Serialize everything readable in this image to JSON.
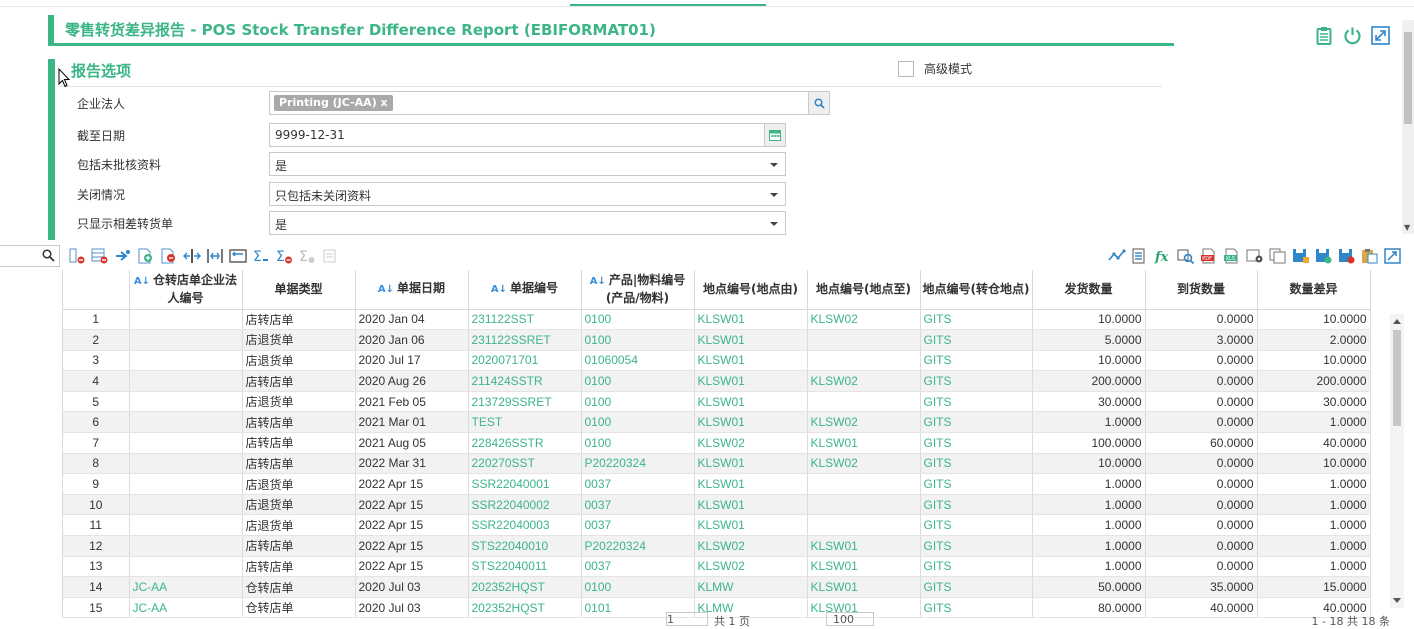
{
  "page": {
    "title": "零售转货差异报告 - POS Stock Transfer Difference Report (EBIFORMAT01)"
  },
  "top_icons": [
    "clipboard-icon",
    "power-icon",
    "expand-icon"
  ],
  "report_options": {
    "title": "报告选项",
    "advanced_label": "高级模式",
    "advanced_checked": false,
    "fields": [
      {
        "label": "企业法人",
        "value": "Printing (JC-AA) x",
        "kind": "tag-search"
      },
      {
        "label": "截至日期",
        "value": "9999-12-31",
        "kind": "date"
      },
      {
        "label": "包括未批核资料",
        "value": "是",
        "kind": "select"
      },
      {
        "label": "关闭情况",
        "value": "只包括未关闭资料",
        "kind": "select"
      },
      {
        "label": "只显示相差转货单",
        "value": "是",
        "kind": "select"
      }
    ]
  },
  "grid": {
    "columns": [
      {
        "label": "",
        "sortable": false
      },
      {
        "label": "仓转店单企业法人编号",
        "sortable": true
      },
      {
        "label": "单据类型",
        "sortable": false
      },
      {
        "label": "单据日期",
        "sortable": true
      },
      {
        "label": "单据编号",
        "sortable": true
      },
      {
        "label": "产品|物料编号(产品/物料)",
        "sortable": true
      },
      {
        "label": "地点编号(地点由)",
        "sortable": false
      },
      {
        "label": "地点编号(地点至)",
        "sortable": false
      },
      {
        "label": "地点编号(转仓地点)",
        "sortable": false
      },
      {
        "label": "发货数量",
        "sortable": false
      },
      {
        "label": "到货数量",
        "sortable": false
      },
      {
        "label": "数量差异",
        "sortable": false
      }
    ],
    "rows": [
      [
        "1",
        "",
        "店转店单",
        "2020 Jan 04",
        "231122SST",
        "0100",
        "KLSW01",
        "KLSW02",
        "GITS",
        "10.0000",
        "0.0000",
        "10.0000"
      ],
      [
        "2",
        "",
        "店退货单",
        "2020 Jan 06",
        "231122SSRET",
        "0100",
        "KLSW01",
        "",
        "GITS",
        "5.0000",
        "3.0000",
        "2.0000"
      ],
      [
        "3",
        "",
        "店退货单",
        "2020 Jul 17",
        "2020071701",
        "01060054",
        "KLSW01",
        "",
        "GITS",
        "10.0000",
        "0.0000",
        "10.0000"
      ],
      [
        "4",
        "",
        "店转店单",
        "2020 Aug 26",
        "211424SSTR",
        "0100",
        "KLSW01",
        "KLSW02",
        "GITS",
        "200.0000",
        "0.0000",
        "200.0000"
      ],
      [
        "5",
        "",
        "店退货单",
        "2021 Feb 05",
        "213729SSRET",
        "0100",
        "KLSW01",
        "",
        "GITS",
        "30.0000",
        "0.0000",
        "30.0000"
      ],
      [
        "6",
        "",
        "店转店单",
        "2021 Mar 01",
        "TEST",
        "0100",
        "KLSW01",
        "KLSW02",
        "GITS",
        "1.0000",
        "0.0000",
        "1.0000"
      ],
      [
        "7",
        "",
        "店转店单",
        "2021 Aug 05",
        "228426SSTR",
        "0100",
        "KLSW02",
        "KLSW01",
        "GITS",
        "100.0000",
        "60.0000",
        "40.0000"
      ],
      [
        "8",
        "",
        "店转店单",
        "2022 Mar 31",
        "220270SST",
        "P20220324",
        "KLSW01",
        "KLSW02",
        "GITS",
        "10.0000",
        "0.0000",
        "10.0000"
      ],
      [
        "9",
        "",
        "店退货单",
        "2022 Apr 15",
        "SSR22040001",
        "0037",
        "KLSW01",
        "",
        "GITS",
        "1.0000",
        "0.0000",
        "1.0000"
      ],
      [
        "10",
        "",
        "店退货单",
        "2022 Apr 15",
        "SSR22040002",
        "0037",
        "KLSW01",
        "",
        "GITS",
        "1.0000",
        "0.0000",
        "1.0000"
      ],
      [
        "11",
        "",
        "店退货单",
        "2022 Apr 15",
        "SSR22040003",
        "0037",
        "KLSW01",
        "",
        "GITS",
        "1.0000",
        "0.0000",
        "1.0000"
      ],
      [
        "12",
        "",
        "店转店单",
        "2022 Apr 15",
        "STS22040010",
        "P20220324",
        "KLSW02",
        "KLSW01",
        "GITS",
        "1.0000",
        "0.0000",
        "1.0000"
      ],
      [
        "13",
        "",
        "店转店单",
        "2022 Apr 15",
        "STS22040011",
        "0037",
        "KLSW02",
        "KLSW01",
        "GITS",
        "1.0000",
        "0.0000",
        "1.0000"
      ],
      [
        "14",
        "JC-AA",
        "仓转店单",
        "2020 Jul 03",
        "202352HQST",
        "0100",
        "KLMW",
        "KLSW01",
        "GITS",
        "50.0000",
        "35.0000",
        "15.0000"
      ],
      [
        "15",
        "JC-AA",
        "仓转店单",
        "2020 Jul 03",
        "202352HQST",
        "0101",
        "KLMW",
        "KLSW01",
        "GITS",
        "80.0000",
        "40.0000",
        "40.0000"
      ]
    ]
  },
  "pager": {
    "page_value": "1",
    "page_total": "共 1 页",
    "page_size": "100",
    "range": "1 - 18 共 18 条"
  }
}
